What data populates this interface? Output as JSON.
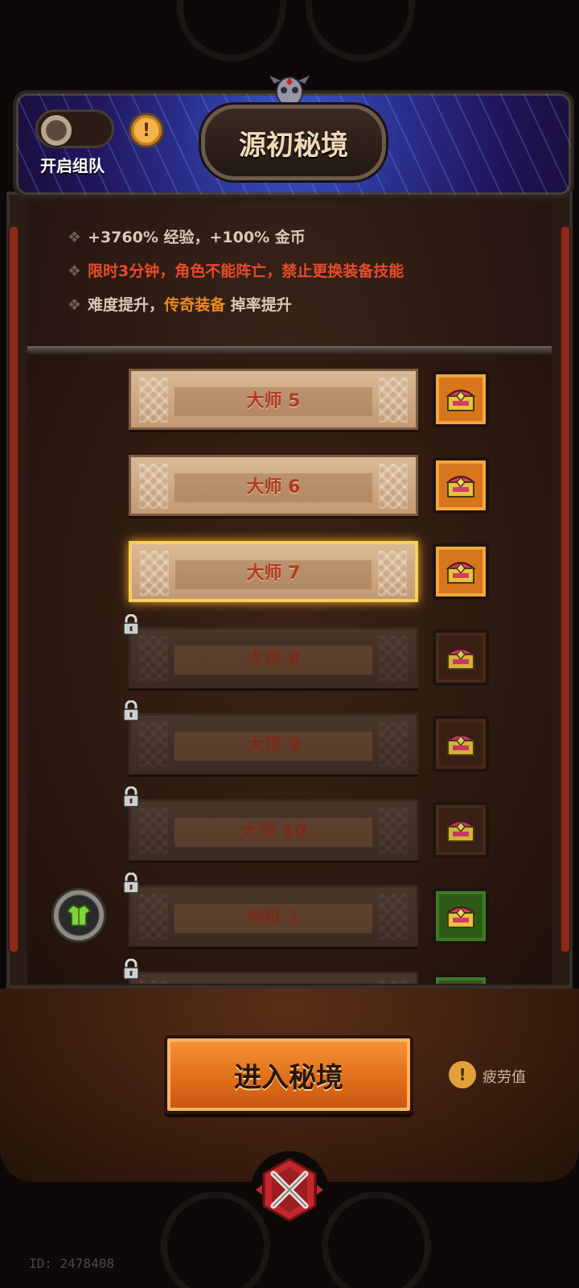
{
  "header": {
    "title": "源初秘境",
    "team_toggle_label": "开启组队"
  },
  "info": {
    "line1": "+3760% 经验，+100% 金币",
    "line2": "限时3分钟，角色不能阵亡，禁止更换装备技能",
    "line3_prefix": "难度提升，",
    "line3_highlight": "传奇装备",
    "line3_suffix": " 掉率提升",
    "bullet": "❖"
  },
  "tiers": [
    {
      "label": "大师 5",
      "locked": false,
      "selected": false
    },
    {
      "label": "大师 6",
      "locked": false,
      "selected": false
    },
    {
      "label": "大师 7",
      "locked": false,
      "selected": true
    },
    {
      "label": "大师 8",
      "locked": true,
      "selected": false
    },
    {
      "label": "大师 9",
      "locked": true,
      "selected": false
    },
    {
      "label": "大师 10",
      "locked": true,
      "selected": false
    },
    {
      "label": "地狱 1",
      "locked": true,
      "selected": false
    },
    {
      "label": "",
      "locked": true,
      "selected": false
    }
  ],
  "footer": {
    "enter_label": "进入秘境",
    "fatigue_label": "疲劳值",
    "fatigue_icon": "!",
    "warn_icon": "!",
    "user_id": "ID: 2478408"
  },
  "colors": {
    "accent_orange": "#e3721c",
    "warning_red": "#e84b2c",
    "legendary_orange": "#f08a1e",
    "selected_gold": "#f7cf5c"
  }
}
